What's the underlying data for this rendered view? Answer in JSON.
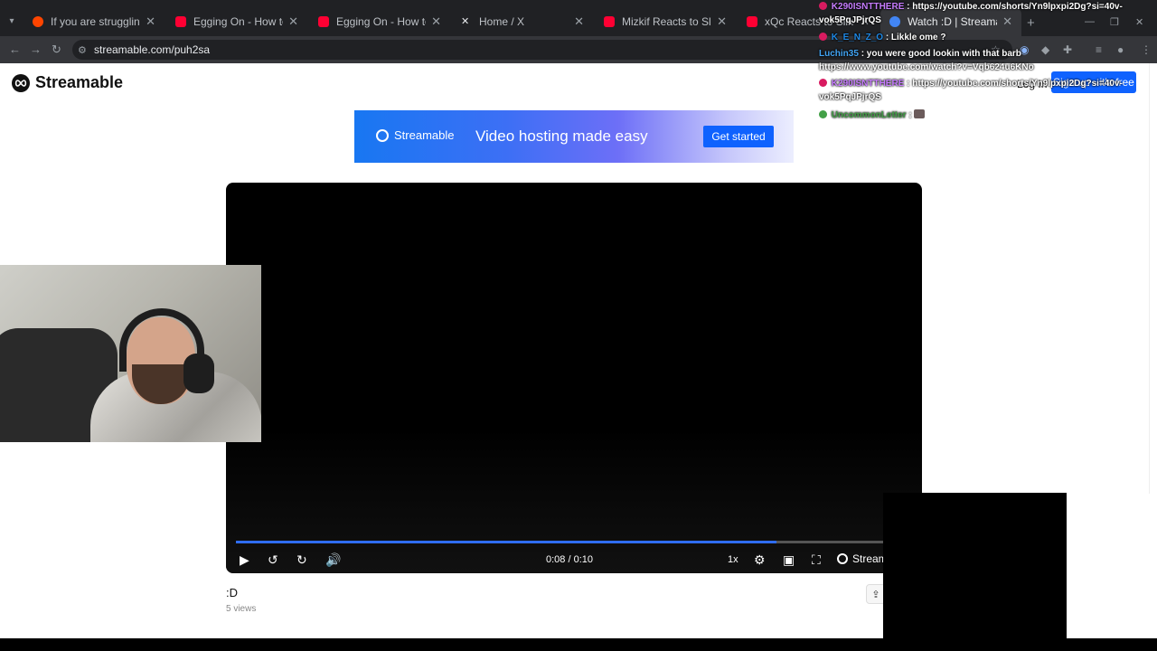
{
  "browser": {
    "tabs": [
      {
        "label": "If you are struggling With egging On",
        "close": "✕",
        "favicon_color": "#ff4500"
      },
      {
        "label": "Egging On - How to unlock The Golden...",
        "close": "✕",
        "favicon_color": "#ff0033"
      },
      {
        "label": "Egging On - How to Unlock Dev Tool...",
        "close": "✕",
        "favicon_color": "#ff0033"
      },
      {
        "label": "Home / X",
        "close": "✕",
        "favicon_color": "#e8eaed"
      },
      {
        "label": "Mizkif Reacts to Sliker Breaking",
        "close": "✕",
        "favicon_color": "#ff0033"
      },
      {
        "label": "xQc Reacts to Sliker",
        "close": "✕",
        "favicon_color": "#ff0033"
      },
      {
        "label": "Watch :D | Streamable",
        "close": "✕",
        "favicon_color": "#4285f4"
      }
    ],
    "new_tab": "+",
    "url": "streamable.com/puh2sa"
  },
  "site": {
    "logo_text": "Streamable",
    "login_link": "Log In",
    "signup_button": "Sign up - it's free"
  },
  "banner": {
    "brand": "Streamable",
    "tagline": "Video hosting made easy",
    "cta": "Get started"
  },
  "player": {
    "progress": 0.8,
    "time": "0:08 / 0:10",
    "speed": "1x",
    "brand": "Streamable"
  },
  "video": {
    "title": ":D",
    "views": "5 views"
  },
  "chat": [
    {
      "user": "K290ISNTTHERE",
      "user_color": "#c77dff",
      "message": ": https://youtube.com/shorts/Yn9lpxpi2Dg?si=40v-",
      "badge_color": "#d81b60"
    },
    {
      "user": "",
      "user_color": "#fff",
      "message": "vok5PqJPjrQS",
      "badge_color": ""
    },
    {
      "user": "K_E_N_Z_O",
      "user_color": "#1e88e5",
      "message": ": Likkle ome ?",
      "badge_color": "#d81b60"
    },
    {
      "user": "Luchin35",
      "user_color": "#42a5f5",
      "message": ": you were good lookin with that barb",
      "badge_color": ""
    },
    {
      "user": "",
      "user_color": "#fff",
      "message": "https://www.youtube.com/watch?v=Vqb624u6KNo",
      "badge_color": ""
    },
    {
      "user": "K290ISNTTHERE",
      "user_color": "#c77dff",
      "message": ": https://youtube.com/shorts/Yn9lpxpi2Dg?si=40v-",
      "badge_color": "#d81b60"
    },
    {
      "user": "",
      "user_color": "#fff",
      "message": "vok5PqJPjrQS",
      "badge_color": ""
    },
    {
      "user": "UncommonLetter",
      "user_color": "#43a047",
      "message": ": ",
      "badge_color": "#43a047"
    }
  ]
}
